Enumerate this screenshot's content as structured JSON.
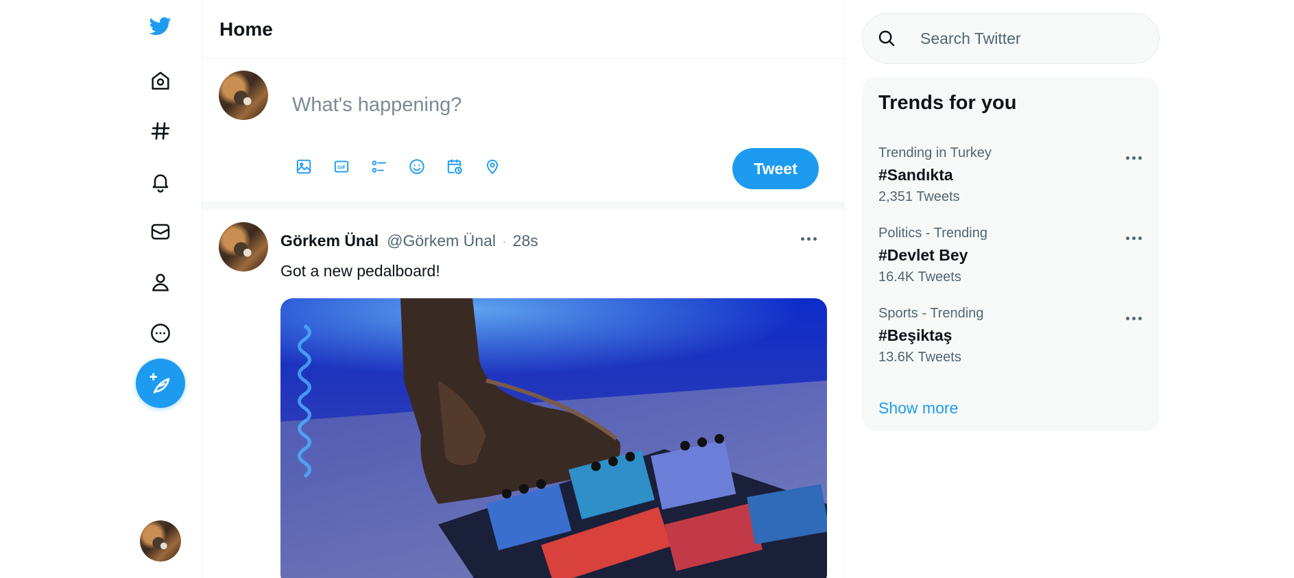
{
  "colors": {
    "accent": "#1d9bf0",
    "text": "#0f1419",
    "muted": "#536471",
    "panel": "#f7f9f9"
  },
  "sidebar": {
    "logo_icon": "twitter-bird-icon",
    "items": [
      {
        "icon": "home-icon",
        "label": "Home"
      },
      {
        "icon": "hashtag-icon",
        "label": "Explore"
      },
      {
        "icon": "bell-icon",
        "label": "Notifications"
      },
      {
        "icon": "mail-icon",
        "label": "Messages"
      },
      {
        "icon": "user-icon",
        "label": "Profile"
      },
      {
        "icon": "more-circle-icon",
        "label": "More"
      }
    ],
    "compose_icon": "feather-plus-icon"
  },
  "main": {
    "title": "Home",
    "composer": {
      "placeholder": "What's happening?",
      "tools": [
        "image-icon",
        "gif-icon",
        "poll-icon",
        "emoji-icon",
        "schedule-icon",
        "location-icon"
      ],
      "tweet_label": "Tweet"
    },
    "tweet": {
      "name": "Görkem Ünal",
      "handle": "@Görkem Ünal",
      "dot": "·",
      "time": "28s",
      "text": "Got a new pedalboard!"
    }
  },
  "right": {
    "search": {
      "placeholder": "Search Twitter"
    },
    "trends": {
      "title": "Trends for you",
      "items": [
        {
          "context": "Trending in Turkey",
          "name": "#Sandıkta",
          "count": "2,351 Tweets"
        },
        {
          "context": "Politics - Trending",
          "name": "#Devlet Bey",
          "count": "16.4K Tweets"
        },
        {
          "context": "Sports - Trending",
          "name": "#Beşiktaş",
          "count": "13.6K Tweets"
        }
      ],
      "show_more": "Show more"
    }
  }
}
